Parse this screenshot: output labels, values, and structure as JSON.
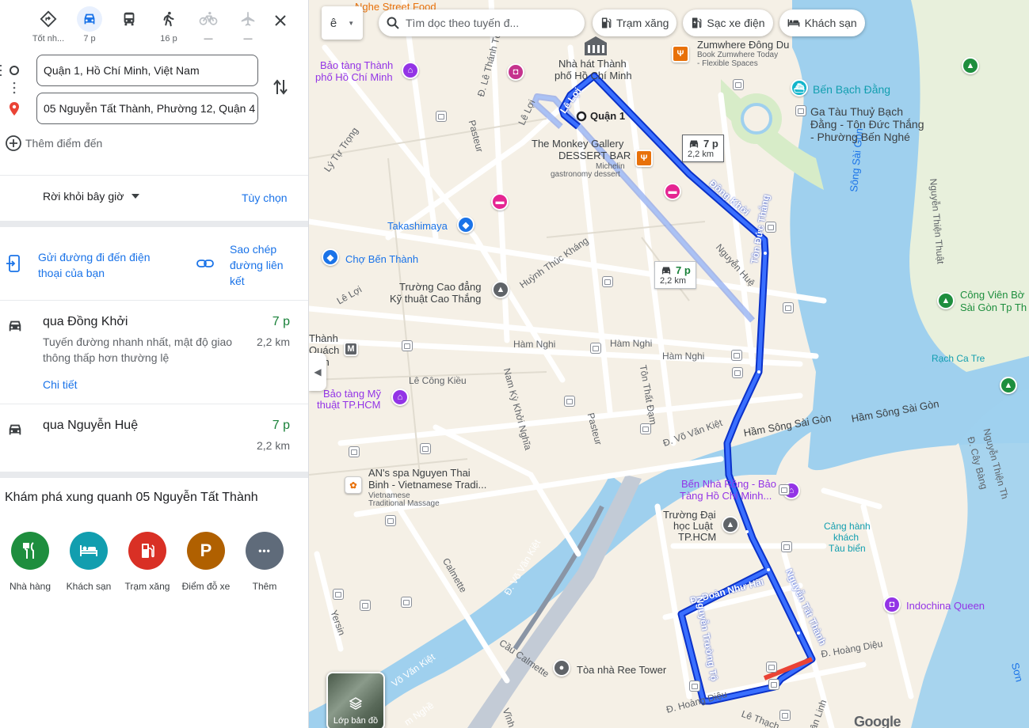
{
  "modes": [
    {
      "name": "best",
      "label": "Tốt nh..."
    },
    {
      "name": "drive",
      "label": "7 p"
    },
    {
      "name": "transit",
      "label": ""
    },
    {
      "name": "walk",
      "label": "16 p"
    },
    {
      "name": "bike",
      "label": "—"
    },
    {
      "name": "flight",
      "label": "—"
    }
  ],
  "origin": "Quận 1, Hồ Chí Minh, Việt Nam",
  "destination": "05 Nguyễn Tất Thành, Phường 12, Quận 4",
  "add_stop": "Thêm điểm đến",
  "depart_label": "Rời khỏi bây giờ",
  "options_label": "Tùy chọn",
  "share": {
    "send_label": "Gửi đường đi đến điện thoại của bạn",
    "send_line1": "Gửi đường đi đến điện",
    "send_line2": "thoại của bạn",
    "copy_line1": "Sao chép",
    "copy_line2": "đường liên",
    "copy_line3": "kết"
  },
  "routes": [
    {
      "name": "qua Đồng Khởi",
      "time": "7 p",
      "dist": "2,2 km",
      "desc": "Tuyến đường nhanh nhất, mật độ giao thông thấp hơn thường lệ",
      "details": "Chi tiết"
    },
    {
      "name": "qua Nguyễn Huệ",
      "time": "7 p",
      "dist": "2,2 km"
    }
  ],
  "explore": {
    "title": "Khám phá xung quanh 05 Nguyễn Tất Thành",
    "categories": [
      {
        "label": "Nhà hàng",
        "color": "#1e8e3e",
        "icon": "restaurant-icon"
      },
      {
        "label": "Khách sạn",
        "color": "#129eaf",
        "icon": "hotel-icon"
      },
      {
        "label": "Trạm xăng",
        "color": "#d93025",
        "icon": "gas-station-icon"
      },
      {
        "label": "Điểm đỗ xe",
        "color": "#b06000",
        "icon": "parking-icon",
        "glyph": "P"
      },
      {
        "label": "Thêm",
        "color": "#5f6b7a",
        "icon": "more-icon",
        "glyph": "•••"
      }
    ]
  },
  "map": {
    "search_placeholder": "Tìm dọc theo tuyến đ...",
    "chips": [
      "Trạm xăng",
      "Sạc xe điện",
      "Khách sạn"
    ],
    "lang_button": "ê",
    "layers_label": "Lớp bản đồ",
    "google_logo": "Google",
    "time_box_1": {
      "time": "7 p",
      "dist": "2,2 km"
    },
    "time_box_2": {
      "time": "7 p",
      "dist": "2,2 km"
    },
    "labels": {
      "street_food": "Nghe Street Food",
      "museum_city": "Bảo tàng Thành",
      "museum_city_2": "phố Hồ Chí Minh",
      "opera": "Nhà hát Thành",
      "opera_2": "phố Hồ Chí Minh",
      "zumwhere": "Zumwhere Đông Du",
      "zumwhere_sub": "Book Zumwhere Today",
      "zumwhere_sub2": "- Flexible Spaces",
      "bach_dang": "Bến Bạch Đằng",
      "ga_tau": "Ga Tàu Thuỷ Bạch",
      "ga_tau_2": "Đằng - Tôn Đức Thắng",
      "ga_tau_3": "- Phường Bến Nghé",
      "quan1": "Quận 1",
      "monkey": "The Monkey Gallery",
      "monkey_2": "DESSERT BAR",
      "michelin": "Michelin",
      "michelin_2": "gastronomy dessert",
      "takashimaya": "Takashimaya",
      "ben_thanh": "Chợ Bến Thành",
      "cao_thang": "Trường Cao đẳng",
      "cao_thang_2": "Kỹ thuật Cao Thắng",
      "ham_nghi_1": "Hàm Nghi",
      "ham_nghi_2": "Hàm Nghi",
      "ham_nghi_3": "Hàm Nghi",
      "thanh": "Thành",
      "quach": "Quách",
      "anh": "ảnh",
      "le_cong_kieu": "Lê Công Kiều",
      "my_thuat": "Bảo tàng Mỹ",
      "my_thuat_2": "thuật TP.HCM",
      "vo_van_kiet": "Đ. Võ Văn Kiệt",
      "ham_song_1": "Hầm Sông Sài Gòn",
      "ham_song_2": "Hầm Sông Sài Gòn",
      "an_spa": "AN's spa Nguyen Thai",
      "an_spa_2": "Binh - Vietnamese Tradi...",
      "an_spa_3": "Vietnamese",
      "an_spa_4": "Traditional Massage",
      "nha_rong": "Bến Nhà Rồng - Bảo",
      "nha_rong_2": "Tàng Hồ Chí Minh...",
      "luat": "Trường Đại",
      "luat_2": "học Luật",
      "luat_3": "TP.HCM",
      "cang": "Cảng hành",
      "cang_2": "khách",
      "cang_3": "Tàu biển",
      "indochina": "Indochina Queen",
      "ree": "Tòa nhà Ree Tower",
      "song_sai_gon": "Sông Sài Gòn",
      "cong_vien": "Công Viên Bờ",
      "cong_vien_2": "Sài Gòn Tp Th",
      "rach_ca_tre": "Rạch Ca Tre",
      "hoang_dieu": "Đ. Hoàng Diệu",
      "hoang_dieu_2": "Đ. Hoàng Diệu",
      "doan_nhu_hai": "Đ. Đoàn Như Hài",
      "nguyen_truong_to": "Nguyễn Trường Tộ",
      "nguyen_tat_thanh": "Nguyễn Tất Thành",
      "ton_duc_thang": "Tôn Đức Thắng",
      "dong_khoi": "Đồng Khởi",
      "nguyen_hue": "Nguyễn Huệ",
      "huynh_thuc_khang": "Huỳnh Thúc Kháng",
      "le_loi_1": "Lê Lợi",
      "le_loi_2": "Lê Lợi",
      "le_loi_3": "Lê Lợi",
      "le_thanh_ton": "Đ. Lê Thánh Tôn",
      "pasteur_1": "Pasteur",
      "pasteur_2": "Pasteur",
      "ly_tu_trong": "Lý Tự Trọng",
      "nam_ky": "Nam Kỳ Khởi Nghĩa",
      "ton_that_dam": "Tôn Thất Đạm",
      "calmette": "Calmette",
      "cau_calmette": "Cầu Calmette",
      "vo_van_kiet_2": "Đ. Võ Văn Kiệt",
      "vo_van_kiet_3": "Võ Văn Kiệt",
      "yersin": "Yersin",
      "nguyen_thien_thuat": "Nguyễn Thiện Thuật",
      "nguyen_thien_thuat_2": "Nguyễn Thiện Th",
      "cay_bang": "Đ. Cây Bàng",
      "le_thach": "Lê Thạch",
      "van_linh": "Vân Linh",
      "nghe": "m Nghề",
      "vinh": "Vĩnh",
      "son": "Sơn"
    }
  }
}
